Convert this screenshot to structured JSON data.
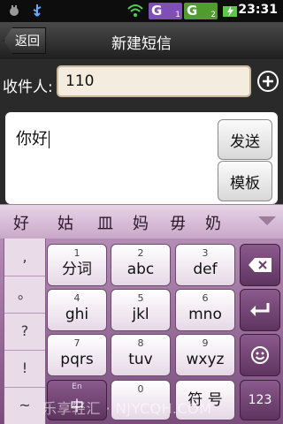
{
  "status": {
    "time": "23:31",
    "signal_badge": "G",
    "sim1": "1",
    "sim2": "2"
  },
  "header": {
    "back_label": "返回",
    "title": "新建短信"
  },
  "recipient": {
    "label": "收件人:",
    "value": "110"
  },
  "message": {
    "text": "你好"
  },
  "actions": {
    "send_label": "发送",
    "template_label": "模板"
  },
  "candidates": [
    "好",
    "姑",
    "皿",
    "妈",
    "毋",
    "奶"
  ],
  "keyboard": {
    "symbols": [
      ",",
      "。",
      "?",
      "!",
      "~"
    ],
    "keys": [
      {
        "num": "1",
        "label": "分词"
      },
      {
        "num": "2",
        "label": "abc"
      },
      {
        "num": "3",
        "label": "def"
      },
      {
        "num": "4",
        "label": "ghi"
      },
      {
        "num": "5",
        "label": "jkl"
      },
      {
        "num": "6",
        "label": "mno"
      },
      {
        "num": "7",
        "label": "pqrs"
      },
      {
        "num": "8",
        "label": "tuv"
      },
      {
        "num": "9",
        "label": "wxyz"
      }
    ],
    "bottom": {
      "lang_small": "En",
      "lang_label": "中",
      "zero": "0",
      "symbol_label": "符 号",
      "num_label": "123"
    }
  },
  "watermark": "乐享轻汇 · NJYCQH.COM"
}
